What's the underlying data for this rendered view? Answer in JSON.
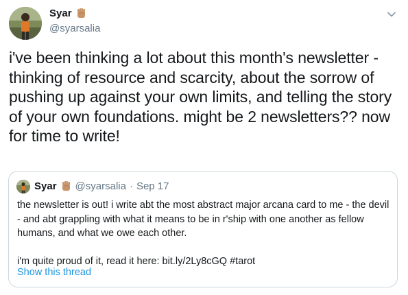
{
  "tweet": {
    "display_name": "Syar",
    "name_emoji": "raised-fist-emoji",
    "handle": "@syarsalia",
    "text": "i've been thinking a lot about this month's newsletter - thinking of resource and scarcity, about the sorrow of pushing up against your own limits, and telling the story of your own foundations. might be 2 newsletters?? now for time to write!"
  },
  "quoted_tweet": {
    "display_name": "Syar",
    "handle": "@syarsalia",
    "separator": "·",
    "date": "Sep 17",
    "paragraph_1": "the newsletter is out! i write abt the most abstract major arcana card to me - the devil - and abt grappling with what it means to be in r'ship with one another as fellow humans, and what we owe each other.",
    "paragraph_2": "i'm quite proud of it, read it here: bit.ly/2Ly8cGQ #tarot",
    "show_thread_label": "Show this thread"
  },
  "colors": {
    "text": "#14171a",
    "muted": "#657786",
    "link": "#1b95e0",
    "border": "#ccd6dd"
  }
}
